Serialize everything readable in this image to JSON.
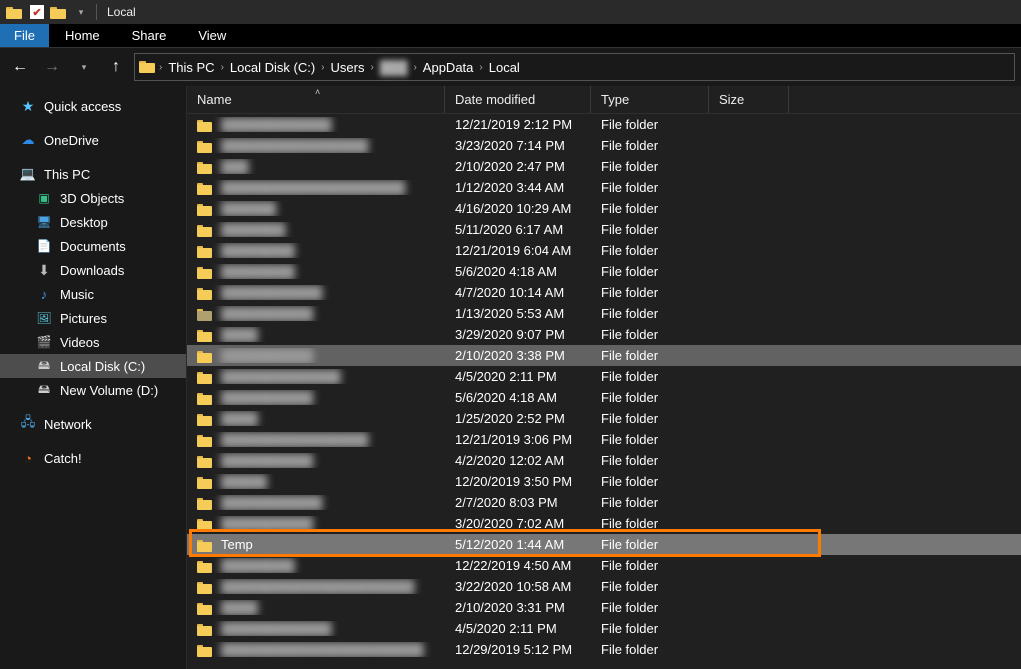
{
  "window": {
    "title": "Local"
  },
  "menu": {
    "file": "File",
    "home": "Home",
    "share": "Share",
    "view": "View"
  },
  "breadcrumb": {
    "root": "This PC",
    "items": [
      "Local Disk (C:)",
      "Users",
      "███",
      "AppData",
      "Local"
    ]
  },
  "sidebar": {
    "quick_access": "Quick access",
    "onedrive": "OneDrive",
    "this_pc": "This PC",
    "objects3d": "3D Objects",
    "desktop": "Desktop",
    "documents": "Documents",
    "downloads": "Downloads",
    "music": "Music",
    "pictures": "Pictures",
    "videos": "Videos",
    "localdisk": "Local Disk (C:)",
    "newvolume": "New Volume (D:)",
    "network": "Network",
    "catch": "Catch!"
  },
  "columns": {
    "name": "Name",
    "date": "Date modified",
    "type": "Type",
    "size": "Size"
  },
  "rows": [
    {
      "name": "████████████",
      "blur": true,
      "date": "12/21/2019 2:12 PM",
      "type": "File folder"
    },
    {
      "name": "████████████████",
      "blur": true,
      "date": "3/23/2020 7:14 PM",
      "type": "File folder"
    },
    {
      "name": "███",
      "blur": true,
      "date": "2/10/2020 2:47 PM",
      "type": "File folder"
    },
    {
      "name": "████████████████████",
      "blur": true,
      "date": "1/12/2020 3:44 AM",
      "type": "File folder"
    },
    {
      "name": "██████",
      "blur": true,
      "date": "4/16/2020 10:29 AM",
      "type": "File folder"
    },
    {
      "name": "███████",
      "blur": true,
      "date": "5/11/2020 6:17 AM",
      "type": "File folder"
    },
    {
      "name": "████████",
      "blur": true,
      "date": "12/21/2019 6:04 AM",
      "type": "File folder"
    },
    {
      "name": "████████",
      "blur": true,
      "date": "5/6/2020 4:18 AM",
      "type": "File folder"
    },
    {
      "name": "███████████",
      "blur": true,
      "date": "4/7/2020 10:14 AM",
      "type": "File folder"
    },
    {
      "name": "██████████",
      "blur": true,
      "muted": true,
      "date": "1/13/2020 5:53 AM",
      "type": "File folder"
    },
    {
      "name": "████",
      "blur": true,
      "date": "3/29/2020 9:07 PM",
      "type": "File folder"
    },
    {
      "name": "██████████",
      "blur": true,
      "sel": 1,
      "date": "2/10/2020 3:38 PM",
      "type": "File folder"
    },
    {
      "name": "█████████████",
      "blur": true,
      "date": "4/5/2020 2:11 PM",
      "type": "File folder"
    },
    {
      "name": "██████████",
      "blur": true,
      "date": "5/6/2020 4:18 AM",
      "type": "File folder"
    },
    {
      "name": "████",
      "blur": true,
      "date": "1/25/2020 2:52 PM",
      "type": "File folder"
    },
    {
      "name": "████████████████",
      "blur": true,
      "date": "12/21/2019 3:06 PM",
      "type": "File folder"
    },
    {
      "name": "██████████",
      "blur": true,
      "date": "4/2/2020 12:02 AM",
      "type": "File folder"
    },
    {
      "name": "█████",
      "blur": true,
      "date": "12/20/2019 3:50 PM",
      "type": "File folder"
    },
    {
      "name": "███████████",
      "blur": true,
      "date": "2/7/2020 8:03 PM",
      "type": "File folder"
    },
    {
      "name": "██████████",
      "blur": true,
      "date": "3/20/2020 7:02 AM",
      "type": "File folder"
    },
    {
      "name": "Temp",
      "blur": false,
      "sel": 2,
      "highlight": true,
      "date": "5/12/2020 1:44 AM",
      "type": "File folder"
    },
    {
      "name": "████████",
      "blur": true,
      "date": "12/22/2019 4:50 AM",
      "type": "File folder"
    },
    {
      "name": "█████████████████████",
      "blur": true,
      "date": "3/22/2020 10:58 AM",
      "type": "File folder"
    },
    {
      "name": "████",
      "blur": true,
      "date": "2/10/2020 3:31 PM",
      "type": "File folder"
    },
    {
      "name": "████████████",
      "blur": true,
      "date": "4/5/2020 2:11 PM",
      "type": "File folder"
    },
    {
      "name": "██████████████████████",
      "blur": true,
      "date": "12/29/2019 5:12 PM",
      "type": "File folder"
    }
  ]
}
